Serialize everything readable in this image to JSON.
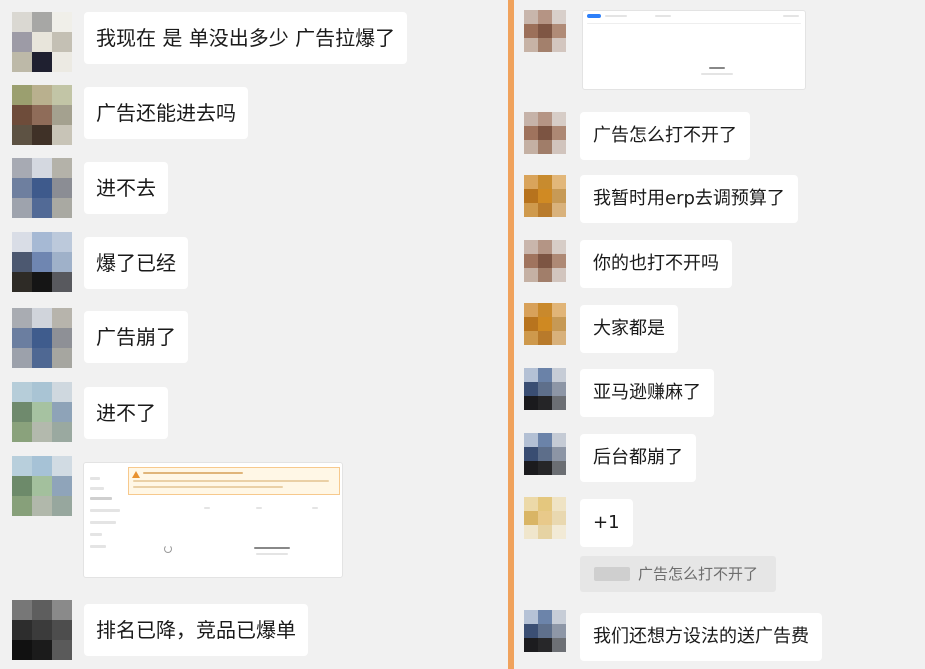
{
  "left_messages": [
    {
      "text": "我现在 是 单没出多少  广告拉爆了",
      "avatar": [
        "#dad8d2",
        "#a7a7a5",
        "#f0efe9",
        "#9d9ba6",
        "#e8e5db",
        "#c4c0b4",
        "#bdb9a8",
        "#1f2030",
        "#eceae3"
      ]
    },
    {
      "text": "广告还能进去吗",
      "avatar": [
        "#9b9f6f",
        "#b9b08e",
        "#c2c5a6",
        "#6e4c3a",
        "#8f6c59",
        "#a4a18f",
        "#5d5243",
        "#3f3127",
        "#c8c4b7"
      ]
    },
    {
      "text": "进不去",
      "avatar": [
        "#a7aab3",
        "#d4d8e0",
        "#b4b2a9",
        "#6e7f9f",
        "#3e5a8c",
        "#8b8d94",
        "#9ea3ad",
        "#526a96",
        "#a9a9a2"
      ]
    },
    {
      "text": "爆了已经",
      "avatar": [
        "#d9dde6",
        "#a6b9d4",
        "#bcc9db",
        "#4c5870",
        "#6f86b1",
        "#9fb1c9",
        "#2e2b26",
        "#151515",
        "#58595e"
      ]
    },
    {
      "text": "广告崩了",
      "avatar": [
        "#a9acb2",
        "#d0d4db",
        "#b7b4ac",
        "#6b7ea0",
        "#3f5c8d",
        "#8e9096",
        "#9ca1ab",
        "#4f6893",
        "#a6a6a0"
      ]
    },
    {
      "text": "进不了",
      "avatar": [
        "#b6cdd9",
        "#a9c4d4",
        "#cfd8df",
        "#6f8a6d",
        "#a6c2a1",
        "#8ea3b8",
        "#8aa27c",
        "#b3b9ad",
        "#9aa9a0"
      ]
    },
    {
      "text": "",
      "avatar": [
        "#b8cfdc",
        "#a6c2d6",
        "#d1dbe3",
        "#6d8a6a",
        "#a3c09d",
        "#8fa4ba",
        "#87a07a",
        "#b1b8ab",
        "#97a79e"
      ]
    },
    {
      "text": "排名已降，竞品已爆单",
      "avatar": [
        "#777777",
        "#5e5e5e",
        "#8a8a8a",
        "#2d2d2d",
        "#3b3b3b",
        "#4d4d4d",
        "#111111",
        "#1b1b1b",
        "#5a5a5a"
      ]
    }
  ],
  "right_messages": [
    {
      "text": "",
      "avatar": [
        "#c8b6ac",
        "#b59484",
        "#d8cfca",
        "#9c705a",
        "#7f5644",
        "#b08b77",
        "#c7b3a6",
        "#a3806c",
        "#d3c6bf"
      ]
    },
    {
      "text": "广告怎么打不开了",
      "avatar": [
        "#c6b3a9",
        "#b59585",
        "#d7cdc7",
        "#9f735d",
        "#7c5442",
        "#ad8874",
        "#c4b0a3",
        "#a07d69",
        "#d1c4bd"
      ]
    },
    {
      "text": "我暂时用erp去调预算了",
      "avatar": [
        "#d9a45b",
        "#c88b2e",
        "#e2b77a",
        "#b7731d",
        "#d08a23",
        "#c79a56",
        "#cf9a4d",
        "#b97b2c",
        "#d9b27c"
      ]
    },
    {
      "text": "你的也打不开吗",
      "avatar": [
        "#c9b6ac",
        "#b49585",
        "#d7cdc7",
        "#a0745e",
        "#7d5543",
        "#ae8975",
        "#c5b1a4",
        "#a17e6a",
        "#d2c5be"
      ]
    },
    {
      "text": "大家都是",
      "avatar": [
        "#d8a15a",
        "#c9892c",
        "#e1b578",
        "#b8741e",
        "#cf8922",
        "#c69955",
        "#ce994c",
        "#b87a2b",
        "#d8b17b"
      ]
    },
    {
      "text": "亚马逊赚麻了",
      "avatar": [
        "#b4c1d5",
        "#6a82a8",
        "#c6ccd6",
        "#3a4e73",
        "#5e6f8b",
        "#8d96a6",
        "#1a1a1d",
        "#252527",
        "#6c6f74"
      ]
    },
    {
      "text": "后台都崩了",
      "avatar": [
        "#b3c0d4",
        "#6b83a9",
        "#c5cbd5",
        "#394d72",
        "#5d6e8a",
        "#8c95a5",
        "#1b1b1e",
        "#262628",
        "#6b6e73"
      ]
    },
    {
      "text": "+1",
      "avatar": [
        "#ecd9a8",
        "#e4c77e",
        "#efe3c4",
        "#d9b565",
        "#e8c98a",
        "#e9d8b0",
        "#f0e6cc",
        "#e6d3a3",
        "#f2ead6"
      ]
    },
    {
      "text": "我们还想方设法的送广告费",
      "avatar": [
        "#b5c2d6",
        "#6c84aa",
        "#c7cdd7",
        "#3b4f74",
        "#5f708c",
        "#8e97a7",
        "#1c1c1f",
        "#272729",
        "#6d7075"
      ]
    }
  ],
  "quoted_reply": {
    "text": "广告怎么打不开了"
  },
  "colors": {
    "divider": "#f0a25c",
    "background": "#f1f1f1",
    "bubble": "#ffffff"
  },
  "icons": {
    "warning": "warning-triangle-icon",
    "loading": "loading-spinner-icon"
  }
}
